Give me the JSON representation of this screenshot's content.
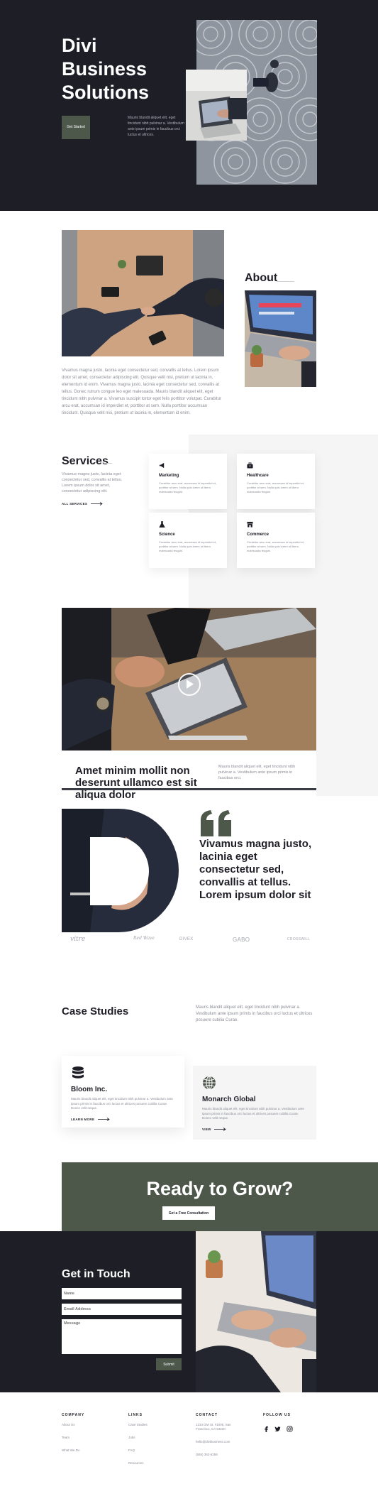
{
  "colors": {
    "dark": "#1e1e27",
    "accent_green": "#4d584b",
    "light_panel": "#f5f5f6",
    "muted_text": "#8a8d96"
  },
  "hero": {
    "title": "Divi Business Solutions",
    "button": "Get Started",
    "text": "Mauris blandit aliquet elit, eget tincidunt nibh pulvinar a. Vestibulum ante ipsum primis in faucibus orci luctus et ultrices."
  },
  "about": {
    "heading": "About",
    "body": "Vivamus magna justo, lacinia eget consectetur sed, convallis at tellus. Lorem ipsum dolor sit amet, consectetur adipiscing elit. Quisque velit nisi, pretium ut lacinia in, elementum id enim. Vivamus magna justo, lacinia eget consectetur sed, convallis at tellus. Donec rutrum congue leo eget malesuada. Mauris blandit aliquet elit, eget tincidunt nibh pulvinar a. Vivamus suscipit tortor eget felis porttitor volutpat. Curabitur arcu erat, accumsan id imperdiet et, porttitor at sem. Nulla porttitor accumsan tincidunt. Quisque velit nisi, pretium ut lacinia in, elementum id enim."
  },
  "services": {
    "heading": "Services",
    "body": "Vivamus magna justo, lacinia eget consectetur sed, convallis at tellus. Lorem ipsum dolor sit amet, consectetur adipiscing elit.",
    "link": "ALL SERVICES",
    "items": [
      {
        "icon": "megaphone-icon",
        "title": "Marketing",
        "text": "Curabitur arcu erat, accumsan id imperdiet et, porttitor at sem. Nulla quis lorem ut libero malesuada feugiat."
      },
      {
        "icon": "briefcase-icon",
        "title": "Healthcare",
        "text": "Curabitur arcu erat, accumsan id imperdiet et, porttitor at sem. Nulla quis lorem ut libero malesuada feugiat."
      },
      {
        "icon": "flask-icon",
        "title": "Science",
        "text": "Curabitur arcu erat, accumsan id imperdiet et, porttitor at sem. Nulla quis lorem ut libero malesuada feugiat."
      },
      {
        "icon": "store-icon",
        "title": "Commerce",
        "text": "Curabitur arcu erat, accumsan id imperdiet et, porttitor at sem. Nulla quis lorem ut libero malesuada feugiat."
      }
    ]
  },
  "video": {
    "heading": "Amet minim mollit non deserunt ullamco est sit aliqua dolor",
    "text": "Mauris blandit aliquet elit, eget tincidunt nibh pulvinar a. Vestibulum ante ipsum primis in faucibus orci."
  },
  "quote": {
    "text": "Vivamus magna justo, lacinia eget consectetur sed, convallis at tellus. Lorem ipsum dolor sit"
  },
  "logos": [
    "vitre",
    "Red Wave",
    "DIVEX",
    "GABO",
    "CROSSWILL"
  ],
  "cases": {
    "heading": "Case Studies",
    "intro": "Mauris blandit aliquet elit, eget tincidunt nibh pulvinar a. Vestibulum ante ipsum primis in faucibus orci luctus et ultrices posuere cubilia Curae.",
    "items": [
      {
        "icon": "database-icon",
        "title": "Bloom Inc.",
        "text": "Mauris blandit aliquet elit, eget tincidunt nibh pulvinar a. Vestibulum ante ipsum primis in faucibus orci luctus et ultrices posuere cubilia Curae. Donec velit neque.",
        "link": "LEARN MORE"
      },
      {
        "icon": "globe-icon",
        "title": "Monarch Global",
        "text": "Mauris blandit aliquet elit, eget tincidunt nibh pulvinar a. Vestibulum ante ipsum primis in faucibus orci luctus et ultrices posuere cubilia Curae. Donec velit neque.",
        "link": "VIEW"
      }
    ]
  },
  "cta": {
    "heading": "Ready to Grow?",
    "button": "Get a Free Consultation"
  },
  "contact": {
    "heading": "Get in Touch",
    "name_placeholder": "Name",
    "email_placeholder": "Email Address",
    "message_placeholder": "Message",
    "submit": "Submit"
  },
  "footer": {
    "company_heading": "COMPANY",
    "company_links": [
      "About Us",
      "Team",
      "What We Do"
    ],
    "links_heading": "LINKS",
    "links": [
      "Case Studies",
      "Jobs",
      "FAQ",
      "Resources"
    ],
    "contact_heading": "CONTACT",
    "address": "1234 Divi St. #1000, San Francisco, CA 94220",
    "email": "hello@divibusiness.com",
    "phone": "(555) 352-6258",
    "follow_heading": "FOLLOW US",
    "social": [
      "facebook-icon",
      "twitter-icon",
      "instagram-icon"
    ]
  }
}
